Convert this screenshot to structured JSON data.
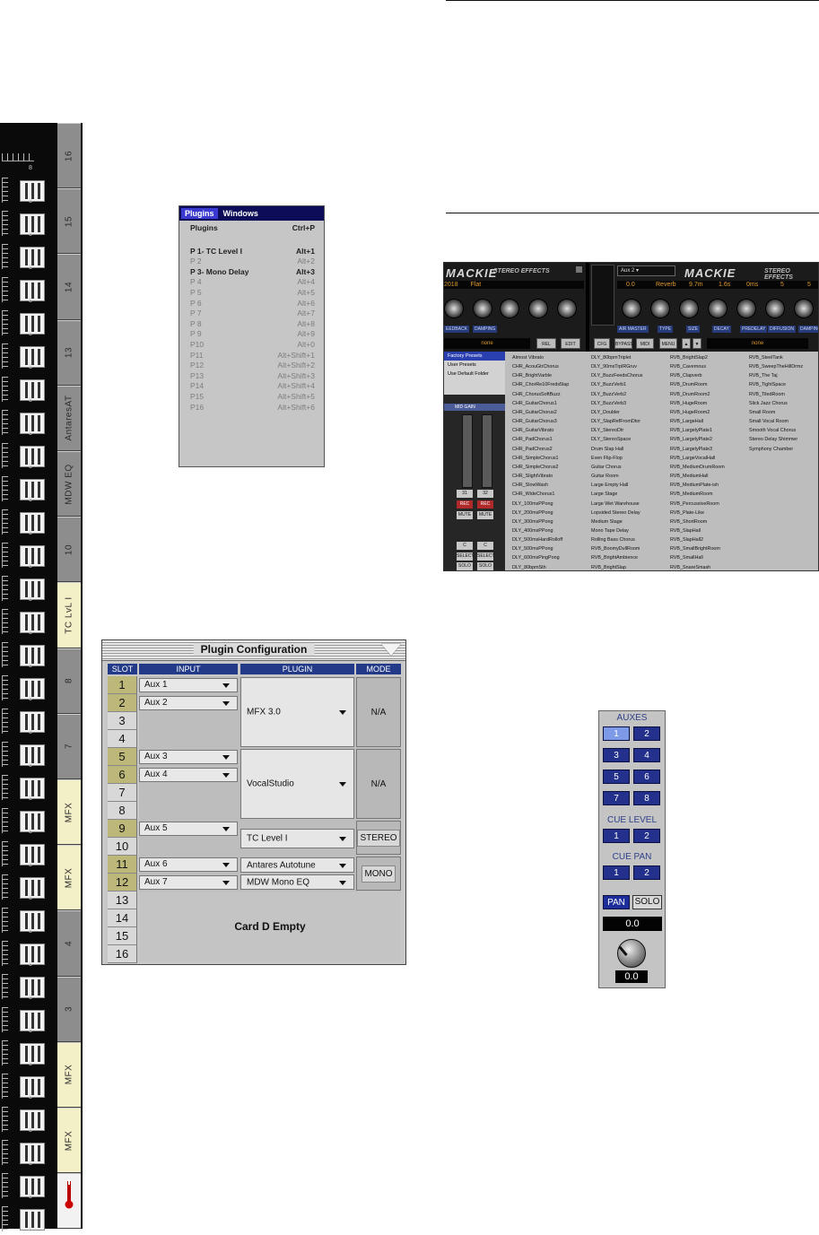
{
  "strip": {
    "tabs": [
      "16",
      "15",
      "14",
      "13",
      "AntaresAT",
      "MDW EQ",
      "10",
      "TC LvL I",
      "8",
      "7",
      "MFX",
      "MFX",
      "4",
      "3",
      "MFX",
      "MFX"
    ],
    "yellow_tabs": [
      7,
      10,
      11,
      14,
      15
    ],
    "fader_label": "8"
  },
  "plugins_menu": {
    "menu_plugins": "Plugins",
    "menu_windows": "Windows",
    "header_item": {
      "label": "Plugins",
      "shortcut": "Ctrl+P"
    },
    "items": [
      {
        "label": "P 1- TC Level I",
        "shortcut": "Alt+1",
        "enabled": true
      },
      {
        "label": "P 2",
        "shortcut": "Alt+2",
        "enabled": false
      },
      {
        "label": "P 3- Mono Delay",
        "shortcut": "Alt+3",
        "enabled": true
      },
      {
        "label": "P 4",
        "shortcut": "Alt+4",
        "enabled": false
      },
      {
        "label": "P 5",
        "shortcut": "Alt+5",
        "enabled": false
      },
      {
        "label": "P 6",
        "shortcut": "Alt+6",
        "enabled": false
      },
      {
        "label": "P 7",
        "shortcut": "Alt+7",
        "enabled": false
      },
      {
        "label": "P 8",
        "shortcut": "Alt+8",
        "enabled": false
      },
      {
        "label": "P 9",
        "shortcut": "Alt+9",
        "enabled": false
      },
      {
        "label": "P10",
        "shortcut": "Alt+0",
        "enabled": false
      },
      {
        "label": "P11",
        "shortcut": "Alt+Shift+1",
        "enabled": false
      },
      {
        "label": "P12",
        "shortcut": "Alt+Shift+2",
        "enabled": false
      },
      {
        "label": "P13",
        "shortcut": "Alt+Shift+3",
        "enabled": false
      },
      {
        "label": "P14",
        "shortcut": "Alt+Shift+4",
        "enabled": false
      },
      {
        "label": "P15",
        "shortcut": "Alt+Shift+5",
        "enabled": false
      },
      {
        "label": "P16",
        "shortcut": "Alt+Shift+6",
        "enabled": false
      }
    ]
  },
  "plugin_config": {
    "title": "Plugin Configuration",
    "headers": {
      "slot": "SLOT",
      "input": "INPUT",
      "plugin": "PLUGIN",
      "mode": "MODE"
    },
    "slots": [
      "1",
      "2",
      "3",
      "4",
      "5",
      "6",
      "7",
      "8",
      "9",
      "10",
      "11",
      "12",
      "13",
      "14",
      "15",
      "16"
    ],
    "inputs": {
      "1": "Aux 1",
      "2": "Aux 2",
      "5": "Aux 3",
      "6": "Aux 4",
      "9": "Aux 5",
      "11": "Aux 6",
      "12": "Aux 7"
    },
    "plugins": {
      "mfx": "MFX 3.0",
      "vocal": "VocalStudio",
      "tc": "TC Level I",
      "antares": "Antares Autotune",
      "mdw": "MDW Mono EQ"
    },
    "modes": {
      "g1": "N/A",
      "g2": "N/A",
      "g3": "STEREO",
      "g4": "MONO"
    },
    "empty_card": "Card D Empty"
  },
  "mackie": {
    "brand": "MACKIE",
    "subtitle": "STEREO EFFECTS",
    "aux_select": "Aux 2",
    "left_lcd": [
      "2018",
      "Flat"
    ],
    "lcd_values": [
      "0.0",
      "Reverb",
      "9.7m",
      "1.6s",
      "0ms",
      "5",
      "5"
    ],
    "param_labels": [
      "EEDBACK",
      "DAMPING",
      "AIR MASTER",
      "TYPE",
      "SIZE",
      "DECAY",
      "PREDELAY",
      "DIFFUSION",
      "DAMPING"
    ],
    "preset_name_left": "none",
    "preset_name_right": "none",
    "buttons_left": [
      "REL",
      "EDIT"
    ],
    "buttons_right": [
      "CFG",
      "BYPASS",
      "MIDI",
      "MENU"
    ],
    "submenu": [
      "Factory Presets",
      "User Presets",
      "Use Default Folder"
    ],
    "strip_labels": {
      "midgain": "MID GAIN",
      "ch1": "31",
      "ch2": "32",
      "rec": "REC",
      "mute": "MUTE",
      "select": "SELECT",
      "solo": "SOLO",
      "c": "C"
    },
    "presets": [
      [
        "Almost Vibrato",
        "CHR_AcouGtrChorus",
        "CHR_BrightVarble",
        "CHR_ChorRe10Freds5lap",
        "CHR_ChorusSoftBuzz",
        "CHR_GuitarChorus1",
        "CHR_GuitarChorus2",
        "CHR_GuitarChorus3",
        "CHR_GuitarVibrato",
        "CHR_PadChorus1",
        "CHR_PadChorus2",
        "CHR_SimpleChorus1",
        "CHR_SimpleChorus2",
        "CHR_SlightVibrato",
        "CHR_SlowWash",
        "CHR_WideChorus1",
        "DLY_100msPPong",
        "DLY_200msPPong",
        "DLY_300msPPong",
        "DLY_400msPPong",
        "DLY_500msHardRolloff",
        "DLY_500msPPong",
        "DLY_600msPingPong",
        "DLY_80bpmSth"
      ],
      [
        "DLY_80bpmTriplet",
        "DLY_90msTrplRGruv",
        "DLY_BuzzFeedsChorus",
        "DLY_BuzzVerb1",
        "DLY_BuzzVerb2",
        "DLY_BuzzVerb3",
        "DLY_Doubler",
        "DLY_SlapRefFromDtor",
        "DLY_StereoDtr",
        "DLY_StereoSpace",
        "Drum Slap Hall",
        "Even Flip-Flop",
        "Guitar Chorus",
        "Guitar Room",
        "Large Empty Hall",
        "Large Stage",
        "Large Wet Warehouse",
        "Lopsided Stereo Delay",
        "Medium Stage",
        "Mono Tape Delay",
        "Rolling Bass Chorus",
        "RVB_BoomyDullRoom",
        "RVB_BrightAmbience",
        "RVB_BrightSlap"
      ],
      [
        "RVB_BrightSlap2",
        "RVB_Cavernous",
        "RVB_Clapverb",
        "RVB_DrumRoom",
        "RVB_DrumRoom2",
        "RVB_HugeRoom",
        "RVB_HugeRoom2",
        "RVB_LargeHall",
        "RVB_LargelyPlate1",
        "RVB_LargelyPlate2",
        "RVB_LargelyPlate3",
        "RVB_LargeVocalHall",
        "RVB_MediumDrumRoom",
        "RVB_MediumHall",
        "RVB_MediumPlate-ish",
        "RVB_MediumRoom",
        "RVB_PercussiveRoom",
        "RVB_Plate-Like",
        "RVB_ShortRoom",
        "RVB_SlapHall",
        "RVB_SlapHall2",
        "RVB_SmallBrightRoom",
        "RVB_SmallHall",
        "RVB_SnareSmash"
      ],
      [
        "RVB_SteelTank",
        "RVB_SweepTheHillDrmz",
        "RVB_The Taj",
        "RVB_TightSpace",
        "RVB_TiledRoom",
        "Slick Jazz Chorus",
        "Small Room",
        "Small Vocal Room",
        "Smooth Vocal Chorus",
        "Stereo Delay Shimmer",
        "Symphony Chamber"
      ]
    ]
  },
  "auxes": {
    "title": "AUXES",
    "buttons": [
      "1",
      "2",
      "3",
      "4",
      "5",
      "6",
      "7",
      "8"
    ],
    "cue_level_title": "CUE LEVEL",
    "cue_level": [
      "1",
      "2"
    ],
    "cue_pan_title": "CUE PAN",
    "cue_pan": [
      "1",
      "2"
    ],
    "pan_label": "PAN",
    "solo_label": "SOLO",
    "value_top": "0.0",
    "value_bottom": "0.0"
  }
}
